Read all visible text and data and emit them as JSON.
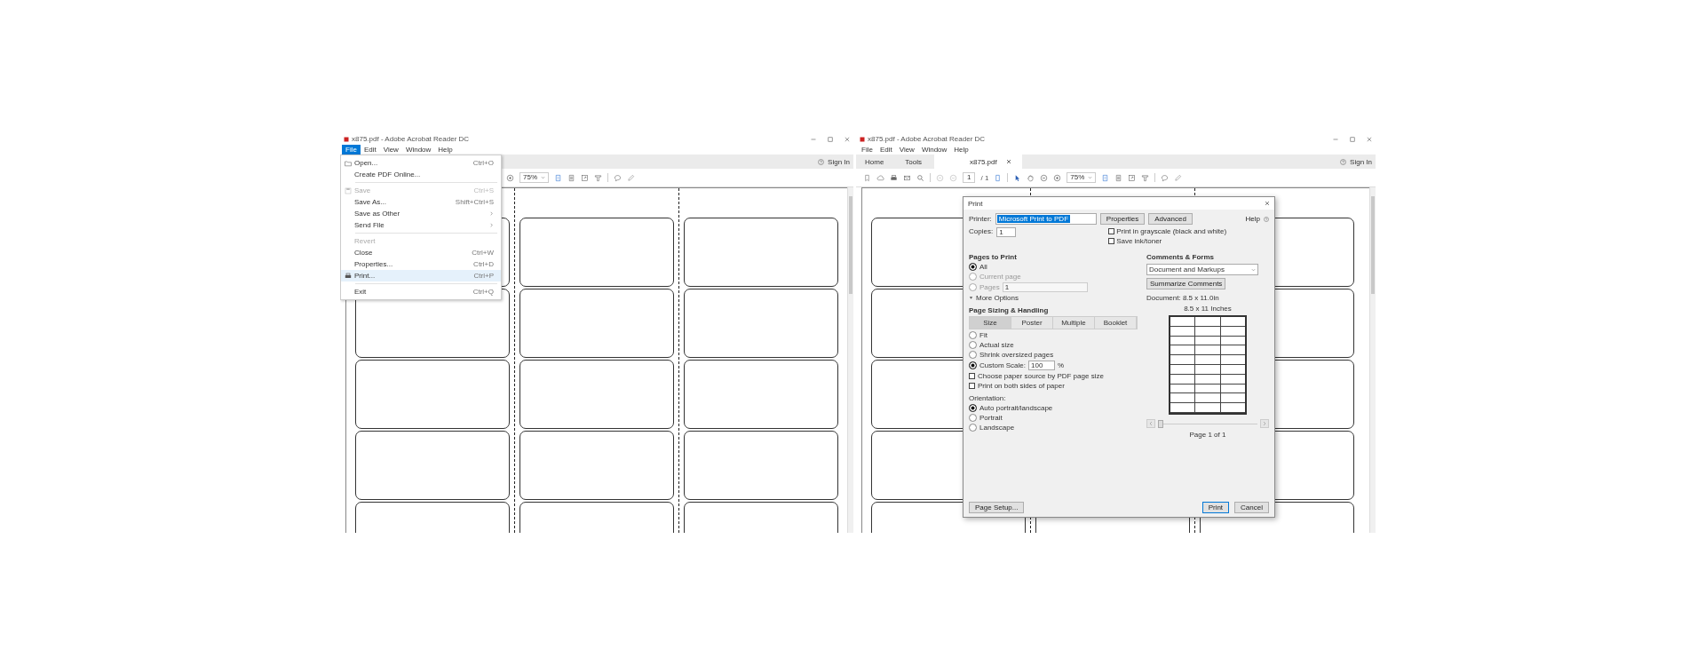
{
  "windows": [
    {
      "title": "x875.pdf - Adobe Acrobat Reader DC",
      "menu": [
        {
          "label": "File",
          "selected": true
        },
        {
          "label": "Edit",
          "selected": false
        },
        {
          "label": "View",
          "selected": false
        },
        {
          "label": "Window",
          "selected": false
        },
        {
          "label": "Help",
          "selected": false
        }
      ],
      "sign_in": "Sign In",
      "zoom": "75%",
      "file_menu": [
        {
          "kind": "item",
          "label": "Open...",
          "shortcut": "Ctrl+O",
          "disabled": false,
          "selected": false
        },
        {
          "kind": "item",
          "label": "Create PDF Online...",
          "disabled": false,
          "selected": false
        },
        {
          "kind": "separator"
        },
        {
          "kind": "item",
          "label": "Save",
          "shortcut": "Ctrl+S",
          "disabled": true,
          "selected": false
        },
        {
          "kind": "item",
          "label": "Save As...",
          "shortcut": "Shift+Ctrl+S",
          "disabled": false,
          "selected": false
        },
        {
          "kind": "submenu",
          "label": "Save as Other",
          "disabled": false,
          "selected": false
        },
        {
          "kind": "submenu",
          "label": "Send File",
          "disabled": false,
          "selected": false
        },
        {
          "kind": "separator"
        },
        {
          "kind": "item",
          "label": "Revert",
          "disabled": true,
          "selected": false
        },
        {
          "kind": "item",
          "label": "Close",
          "shortcut": "Ctrl+W",
          "disabled": false,
          "selected": false
        },
        {
          "kind": "item",
          "label": "Properties...",
          "shortcut": "Ctrl+D",
          "disabled": false,
          "selected": false
        },
        {
          "kind": "item",
          "label": "Print...",
          "shortcut": "Ctrl+P",
          "disabled": false,
          "selected": true
        },
        {
          "kind": "separator"
        },
        {
          "kind": "item",
          "label": "Exit",
          "shortcut": "Ctrl+Q",
          "disabled": false,
          "selected": false
        }
      ]
    },
    {
      "title": "x875.pdf - Adobe Acrobat Reader DC",
      "menu": [
        {
          "label": "File",
          "selected": false
        },
        {
          "label": "Edit",
          "selected": false
        },
        {
          "label": "View",
          "selected": false
        },
        {
          "label": "Window",
          "selected": false
        },
        {
          "label": "Help",
          "selected": false
        }
      ],
      "tabs": [
        {
          "label": "Home",
          "selected": false,
          "closable": false
        },
        {
          "label": "Tools",
          "selected": false,
          "closable": false
        },
        {
          "label": "x875.pdf",
          "selected": true,
          "closable": true
        }
      ],
      "sign_in": "Sign In",
      "page": "1",
      "page_total": "/ 1",
      "zoom": "75%",
      "print_dialog": {
        "title": "Print",
        "printer_label": "Printer:",
        "printer": "Microsoft Print to PDF",
        "buttons_top": [
          "Properties",
          "Advanced"
        ],
        "help": "Help",
        "copies_label": "Copies:",
        "copies": "1",
        "options": [
          {
            "label": "Print in grayscale (black and white)",
            "checked": false
          },
          {
            "label": "Save ink/toner",
            "checked": false
          }
        ],
        "pages_title": "Pages to Print",
        "pages_choices": [
          {
            "label": "All",
            "selected": true,
            "disabled": false
          },
          {
            "label": "Current page",
            "selected": false,
            "disabled": true
          },
          {
            "label": "Pages",
            "selected": false,
            "disabled": true,
            "value": "1"
          }
        ],
        "more_options": "More Options",
        "sizing_title": "Page Sizing & Handling",
        "sizing_tabs": [
          {
            "label": "Size",
            "selected": true
          },
          {
            "label": "Poster",
            "selected": false
          },
          {
            "label": "Multiple",
            "selected": false
          },
          {
            "label": "Booklet",
            "selected": false
          }
        ],
        "sizing_choices": [
          {
            "label": "Fit",
            "selected": false
          },
          {
            "label": "Actual size",
            "selected": false
          },
          {
            "label": "Shrink oversized pages",
            "selected": false
          },
          {
            "label": "Custom Scale:",
            "selected": true,
            "value": "100",
            "unit": "%"
          }
        ],
        "sizing_options": [
          {
            "label": "Choose paper source by PDF page size",
            "checked": false
          },
          {
            "label": "Print on both sides of paper",
            "checked": false
          }
        ],
        "orientation_title": "Orientation:",
        "orientation_choices": [
          {
            "label": "Auto portrait/landscape",
            "selected": true
          },
          {
            "label": "Portrait",
            "selected": false
          },
          {
            "label": "Landscape",
            "selected": false
          }
        ],
        "comments_title": "Comments & Forms",
        "comments_value": "Document and Markups",
        "summarize": "Summarize Comments",
        "document_size": "Document: 8.5 x 11.0in",
        "preview_size": "8.5 x 11 Inches",
        "page_slider": {
          "level": 0
        },
        "page_of": "Page 1 of 1",
        "page_setup": "Page Setup...",
        "print": "Print",
        "cancel": "Cancel"
      }
    }
  ]
}
